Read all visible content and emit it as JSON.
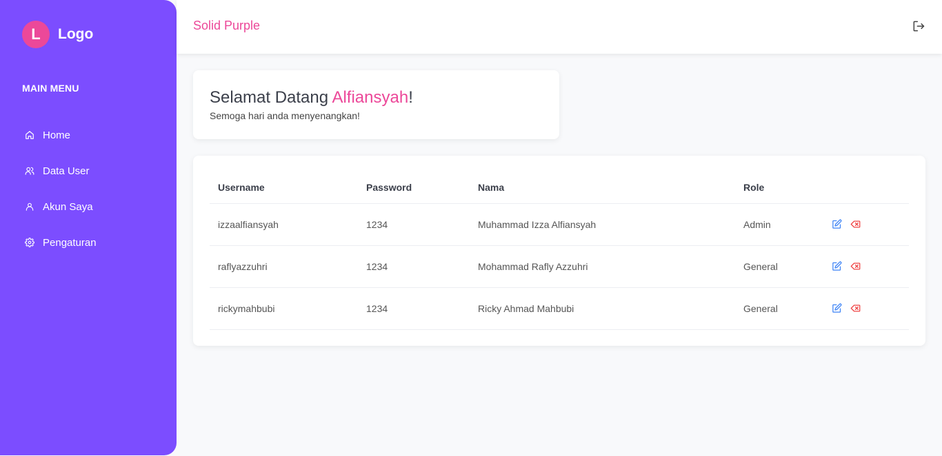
{
  "brand": {
    "badge": "L",
    "text": "Logo"
  },
  "sidebar": {
    "heading": "MAIN MENU",
    "items": [
      {
        "label": "Home",
        "icon": "home-icon"
      },
      {
        "label": "Data User",
        "icon": "users-icon"
      },
      {
        "label": "Akun Saya",
        "icon": "user-icon"
      },
      {
        "label": "Pengaturan",
        "icon": "gear-icon"
      }
    ]
  },
  "topbar": {
    "title": "Solid Purple",
    "logout_icon": "logout-icon"
  },
  "welcome": {
    "greeting": "Selamat Datang ",
    "name": "Alfiansyah",
    "punct": "!",
    "subtitle": "Semoga hari anda menyenangkan!"
  },
  "table": {
    "headers": [
      "Username",
      "Password",
      "Nama",
      "Role",
      ""
    ],
    "rows": [
      {
        "username": "izzaalfiansyah",
        "password": "1234",
        "nama": "Muhammad Izza Alfiansyah",
        "role": "Admin"
      },
      {
        "username": "raflyazzuhri",
        "password": "1234",
        "nama": "Mohammad Rafly Azzuhri",
        "role": "General"
      },
      {
        "username": "rickymahbubi",
        "password": "1234",
        "nama": "Ricky Ahmad Mahbubi",
        "role": "General"
      }
    ]
  },
  "colors": {
    "sidebar": "#7c4dff",
    "accent": "#ec4899",
    "edit": "#3b82f6",
    "delete": "#ef4444"
  }
}
